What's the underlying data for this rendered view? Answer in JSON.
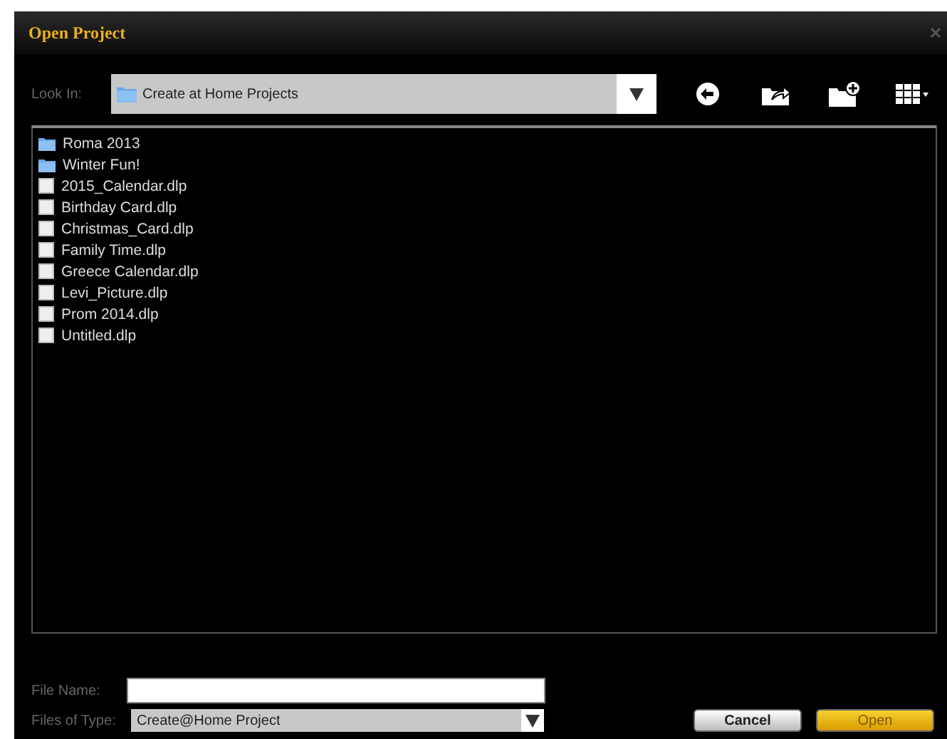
{
  "window": {
    "title": "Open Project"
  },
  "look_in": {
    "label": "Look In:",
    "value": "Create at Home Projects"
  },
  "files": [
    {
      "name": "Roma 2013",
      "kind": "folder"
    },
    {
      "name": "Winter Fun!",
      "kind": "folder"
    },
    {
      "name": "2015_Calendar.dlp",
      "kind": "file"
    },
    {
      "name": "Birthday Card.dlp",
      "kind": "file"
    },
    {
      "name": "Christmas_Card.dlp",
      "kind": "file"
    },
    {
      "name": "Family Time.dlp",
      "kind": "file"
    },
    {
      "name": "Greece Calendar.dlp",
      "kind": "file"
    },
    {
      "name": "Levi_Picture.dlp",
      "kind": "file"
    },
    {
      "name": "Prom 2014.dlp",
      "kind": "file"
    },
    {
      "name": "Untitled.dlp",
      "kind": "file"
    }
  ],
  "file_name": {
    "label": "File Name:"
  },
  "file_type": {
    "label": "Files of Type:",
    "value": "Create@Home Project"
  },
  "buttons": [
    {
      "label": "Cancel",
      "kind": "secondary"
    },
    {
      "label": "Open",
      "kind": "primary"
    }
  ]
}
